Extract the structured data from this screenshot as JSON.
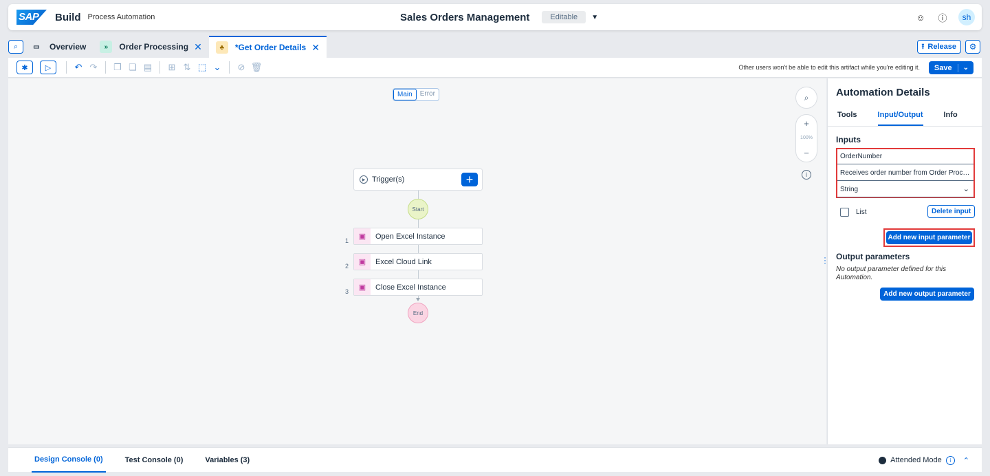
{
  "shell": {
    "logo": "SAP",
    "brand": "Build",
    "product": "Process Automation",
    "title": "Sales Orders Management",
    "status": "Editable",
    "avatar": "sh"
  },
  "tabs": [
    {
      "label": "Overview"
    },
    {
      "label": "Order Processing"
    },
    {
      "label": "*Get Order Details"
    }
  ],
  "release_label": "Release",
  "toolbar": {
    "note": "Other users won't be able to edit this artifact while you're editing it.",
    "save_label": "Save"
  },
  "canvas": {
    "mode_tabs": [
      "Main",
      "Error"
    ],
    "zoom_pct": "100%",
    "trigger_label": "Trigger(s)",
    "start_label": "Start",
    "end_label": "End",
    "steps": [
      {
        "num": "1",
        "label": "Open Excel Instance"
      },
      {
        "num": "2",
        "label": "Excel Cloud Link"
      },
      {
        "num": "3",
        "label": "Close Excel Instance"
      }
    ]
  },
  "panel": {
    "title": "Automation Details",
    "tabs": [
      "Tools",
      "Input/Output",
      "Info"
    ],
    "inputs_heading": "Inputs",
    "input_name": "OrderNumber",
    "input_description": "Receives order number from Order Processing",
    "input_type": "String",
    "list_label": "List",
    "delete_input": "Delete input",
    "add_input": "Add new input parameter",
    "output_heading": "Output parameters",
    "output_message": "No output parameter defined for this Automation.",
    "add_output": "Add new output parameter"
  },
  "bottom": {
    "tabs": [
      "Design Console (0)",
      "Test Console (0)",
      "Variables (3)"
    ],
    "attended": "Attended Mode"
  }
}
